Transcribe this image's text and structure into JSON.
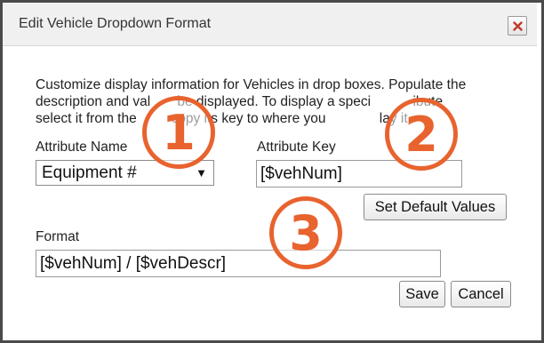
{
  "dialog": {
    "title": "Edit Vehicle Dropdown Format",
    "close_icon": "close-x-icon",
    "accent_color": "#e8632e"
  },
  "description": {
    "line1": "Customize display information for Vehicles in drop boxes. Populate the",
    "line2": "description and val       be displayed. To display a speci           ibute",
    "line3": "select it from the         copy its key to where you              lay it."
  },
  "attribute_name": {
    "label": "Attribute Name",
    "selected": "Equipment #",
    "arrow": "▼"
  },
  "attribute_key": {
    "label": "Attribute Key",
    "value": "[$vehNum]"
  },
  "set_default_button": "Set Default Values",
  "format": {
    "label": "Format",
    "value": "[$vehNum] / [$vehDescr]"
  },
  "save_button": "Save",
  "cancel_button": "Cancel",
  "callouts": [
    "1",
    "2",
    "3"
  ]
}
